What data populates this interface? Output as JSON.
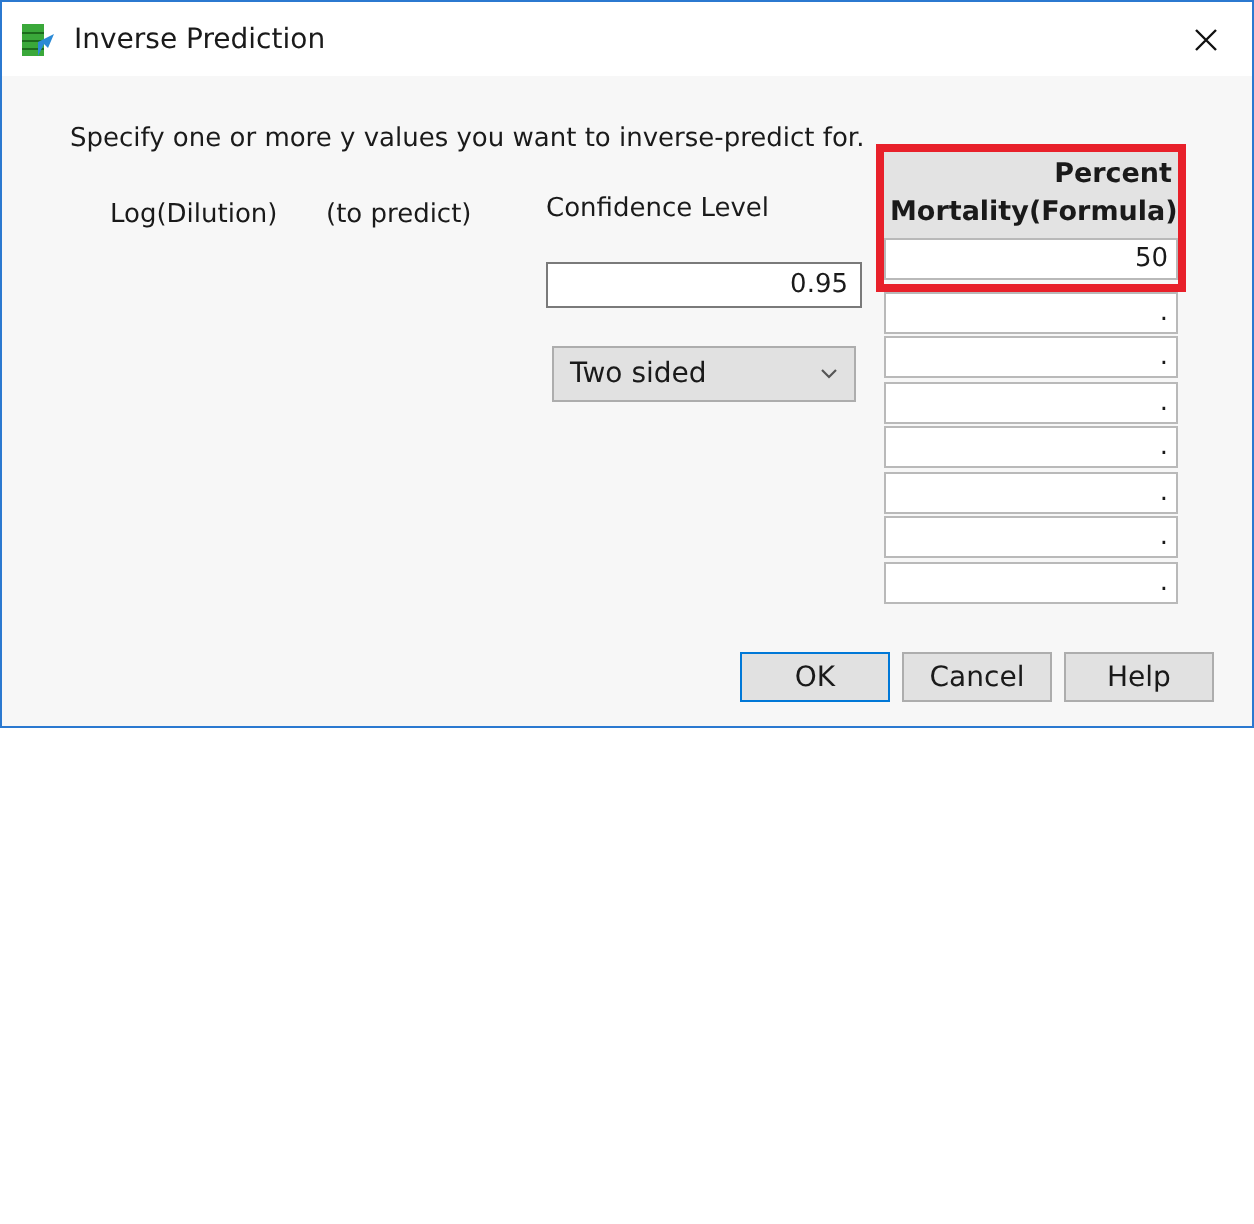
{
  "window": {
    "title": "Inverse Prediction"
  },
  "instruction": "Specify one or more y values you want to inverse-predict for.",
  "x_column": {
    "name": "Log(Dilution)",
    "note": "(to predict)"
  },
  "confidence": {
    "label": "Confidence Level",
    "value": "0.95",
    "sides": "Two sided"
  },
  "y_column": {
    "header_lines": [
      "Percent",
      "Mortality(Formula)"
    ],
    "highlighted": true,
    "values": [
      "50",
      ".",
      ".",
      ".",
      ".",
      ".",
      ".",
      "."
    ]
  },
  "buttons": [
    {
      "label": "OK",
      "default": true
    },
    {
      "label": "Cancel",
      "default": false
    },
    {
      "label": "Help",
      "default": false
    }
  ]
}
